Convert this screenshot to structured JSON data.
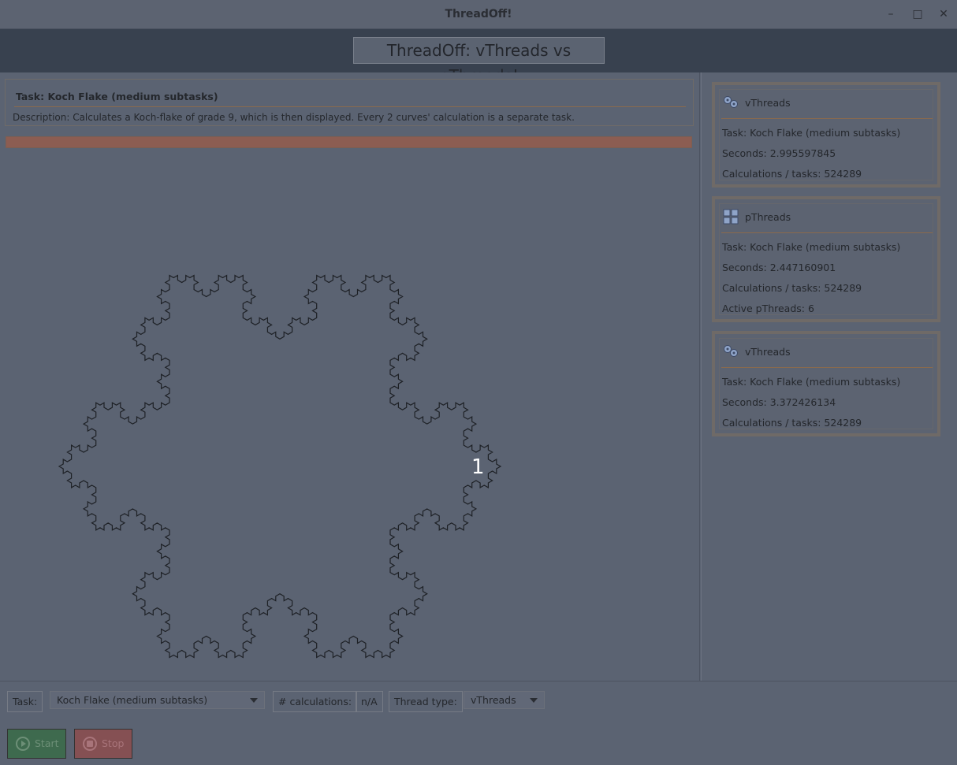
{
  "window": {
    "title": "ThreadOff!"
  },
  "header": {
    "banner": "ThreadOff: vThreads vs pThreads!"
  },
  "task": {
    "title": "Task: Koch Flake (medium subtasks)",
    "description": "Description: Calculates a Koch-flake of grade 9, which is then displayed. Every 2 curves' calculation is a separate task.",
    "progress": 1.0
  },
  "canvas": {
    "thread_count_label": "1",
    "koch_grade_visible": 4
  },
  "results": [
    {
      "icon": "vthreads-icon",
      "name": "vThreads",
      "task": "Task: Koch Flake (medium subtasks)",
      "seconds": "Seconds: 2.995597845",
      "calculations": "Calculations / tasks: 524289"
    },
    {
      "icon": "pthreads-icon",
      "name": "pThreads",
      "task": "Task: Koch Flake (medium subtasks)",
      "seconds": "Seconds: 2.447160901",
      "calculations": "Calculations / tasks: 524289",
      "active": "Active pThreads: 6"
    },
    {
      "icon": "vthreads-icon",
      "name": "vThreads",
      "task": "Task: Koch Flake (medium subtasks)",
      "seconds": "Seconds: 3.372426134",
      "calculations": "Calculations / tasks: 524289"
    }
  ],
  "controls": {
    "task_label": "Task:",
    "task_value": "Koch Flake (medium subtasks)",
    "calc_label": "# calculations:",
    "calc_value": "n/A",
    "thread_label": "Thread type:",
    "thread_value": "vThreads",
    "start_label": "Start",
    "stop_label": "Stop"
  },
  "colors": {
    "overlay_bg": "#5b6372",
    "header_bg": "#38414f",
    "progress_fill": "#8c5d52",
    "start_bg": "#3e6a4e",
    "stop_bg": "#855053"
  }
}
